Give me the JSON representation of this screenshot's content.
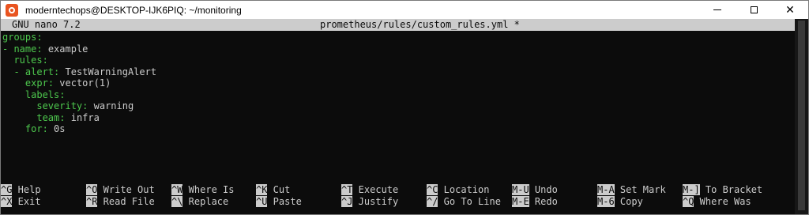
{
  "window": {
    "title": "moderntechops@DESKTOP-IJK6PIQ: ~/monitoring",
    "minimize": "",
    "maximize": "",
    "close": "✕"
  },
  "nano": {
    "version": "GNU nano 7.2",
    "filename": "prometheus/rules/custom_rules.yml *"
  },
  "editor_lines": [
    {
      "indent": "",
      "key": "groups",
      "sep": ":",
      "value": ""
    },
    {
      "indent": "",
      "key": "- name",
      "sep": ":",
      "value": " example"
    },
    {
      "indent": "  ",
      "key": "rules",
      "sep": ":",
      "value": ""
    },
    {
      "indent": "  ",
      "key": "- alert",
      "sep": ":",
      "value": " TestWarningAlert"
    },
    {
      "indent": "    ",
      "key": "expr",
      "sep": ":",
      "value": " vector(1)"
    },
    {
      "indent": "    ",
      "key": "labels",
      "sep": ":",
      "value": ""
    },
    {
      "indent": "      ",
      "key": "severity",
      "sep": ":",
      "value": " warning"
    },
    {
      "indent": "      ",
      "key": "team",
      "sep": ":",
      "value": " infra"
    },
    {
      "indent": "    ",
      "key": "for",
      "sep": ":",
      "value": " 0s"
    }
  ],
  "shortcuts": {
    "row1": [
      {
        "key": "^G",
        "label": " Help"
      },
      {
        "key": "^O",
        "label": " Write Out"
      },
      {
        "key": "^W",
        "label": " Where Is"
      },
      {
        "key": "^K",
        "label": " Cut"
      },
      {
        "key": "^T",
        "label": " Execute"
      },
      {
        "key": "^C",
        "label": " Location"
      },
      {
        "key": "M-U",
        "label": " Undo"
      },
      {
        "key": "M-A",
        "label": " Set Mark"
      },
      {
        "key": "M-]",
        "label": " To Bracket"
      }
    ],
    "row2": [
      {
        "key": "^X",
        "label": " Exit"
      },
      {
        "key": "^R",
        "label": " Read File"
      },
      {
        "key": "^\\",
        "label": " Replace"
      },
      {
        "key": "^U",
        "label": " Paste"
      },
      {
        "key": "^J",
        "label": " Justify"
      },
      {
        "key": "^/",
        "label": " Go To Line"
      },
      {
        "key": "M-E",
        "label": " Redo"
      },
      {
        "key": "M-6",
        "label": " Copy"
      },
      {
        "key": "^Q",
        "label": " Where Was"
      }
    ]
  },
  "colors": {
    "terminal_bg": "#0c0c0c",
    "yaml_key": "#4ec94e",
    "text": "#cccccc",
    "app_icon": "#e95420"
  }
}
